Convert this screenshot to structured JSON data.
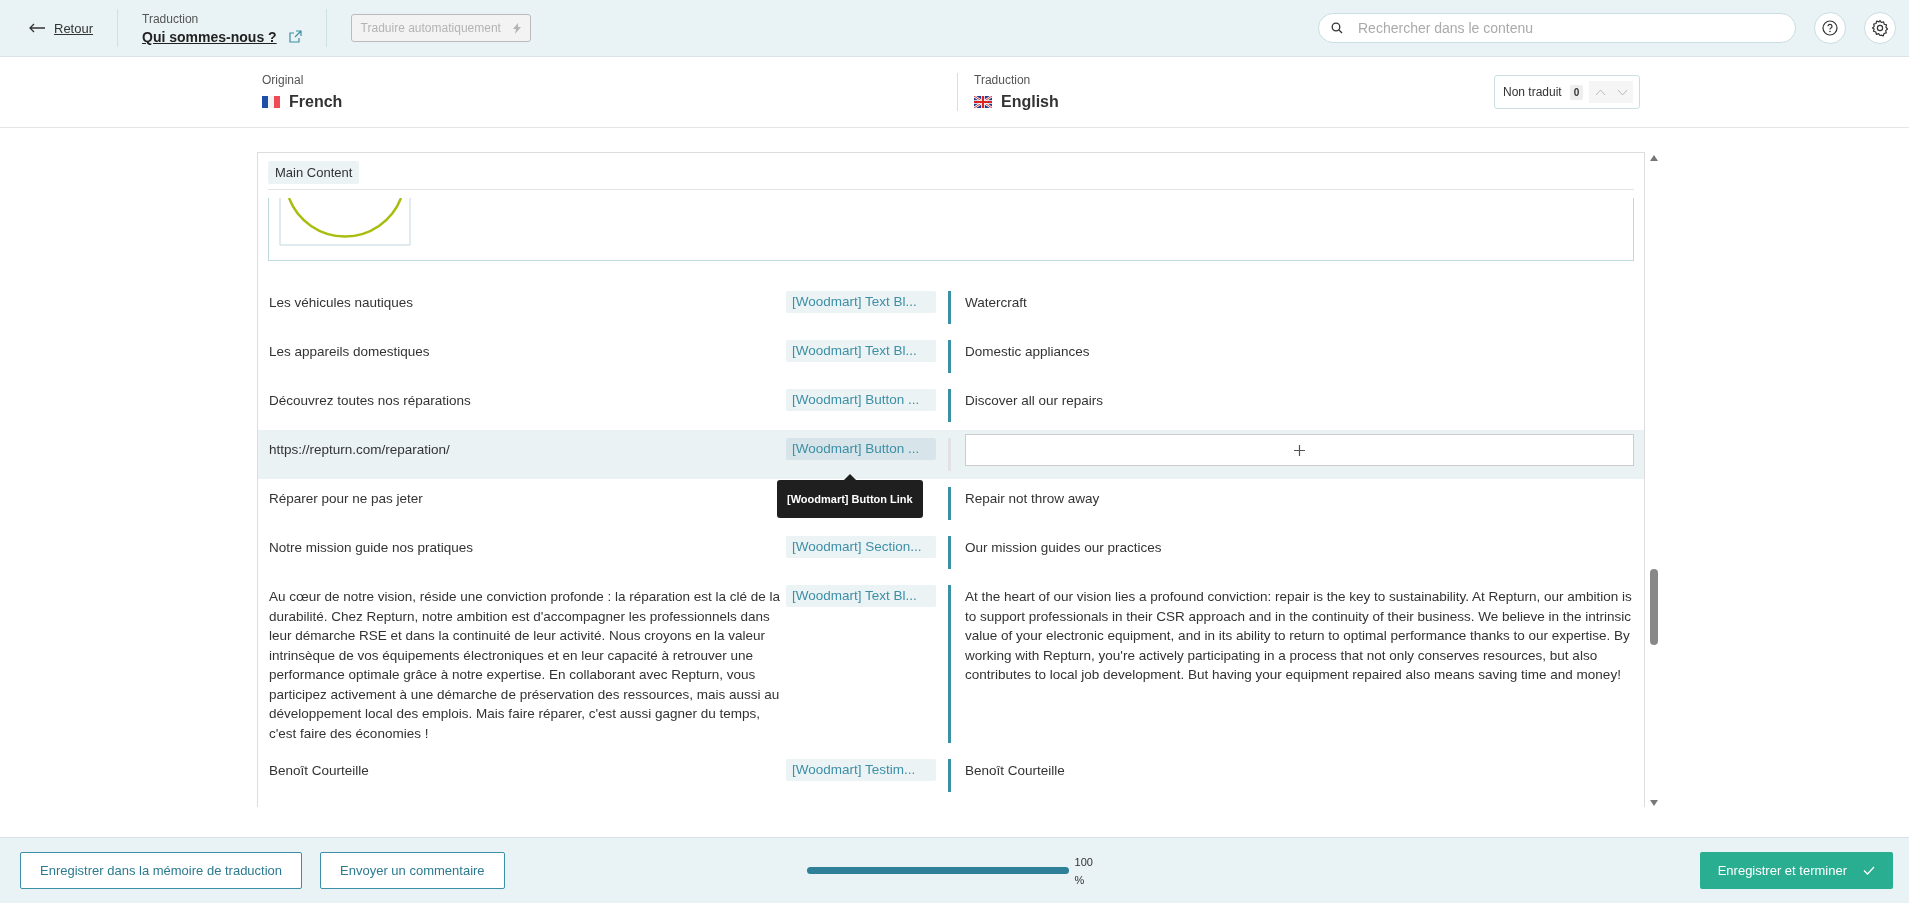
{
  "top_bar": {
    "back": "Retour",
    "section_label": "Traduction",
    "page_title": "Qui sommes-nous ?",
    "auto_translate": {
      "label": "Traduire automatiquement",
      "disabled": true
    },
    "search": {
      "placeholder": "Rechercher dans le contenu"
    }
  },
  "languages": {
    "original": {
      "label": "Original",
      "name": "French"
    },
    "translation": {
      "label": "Traduction",
      "name": "English"
    },
    "filter": {
      "label": "Non traduit",
      "count": "0"
    }
  },
  "section": {
    "title": "Main Content"
  },
  "rows": [
    {
      "source": "Les véhicules nautiques",
      "tag": "[Woodmart] Text Bl...",
      "kind": "translated",
      "translation": "Watercraft",
      "selected": false
    },
    {
      "source": "Les appareils domestiques",
      "tag": "[Woodmart] Text Bl...",
      "kind": "translated",
      "translation": "Domestic appliances",
      "selected": false
    },
    {
      "source": "Découvrez toutes nos réparations",
      "tag": "[Woodmart] Button ...",
      "kind": "translated",
      "translation": "Discover all our repairs",
      "selected": false
    },
    {
      "source": "https://repturn.com/reparation/",
      "tag": "[Woodmart] Button ...",
      "kind": "empty",
      "selected": true,
      "tooltip": "[Woodmart] Button Link"
    },
    {
      "source": "Réparer pour ne pas jeter",
      "kind": "translated",
      "translation": "Repair not throw away",
      "selected": false
    },
    {
      "source": "Notre mission guide nos pratiques",
      "tag": "[Woodmart] Section...",
      "kind": "translated",
      "translation": "Our mission guides our practices",
      "selected": false
    },
    {
      "source": "Au cœur de notre vision, réside une conviction profonde : la réparation est la clé de la durabilité. Chez Repturn, notre ambition est d'accompagner les professionnels dans leur démarche RSE et dans la continuité de leur activité. Nous croyons en la valeur intrinsèque de vos équipements électroniques et en leur capacité à retrouver une performance optimale grâce à notre expertise. En collaborant avec Repturn, vous participez activement à une démarche de préservation des ressources, mais aussi au développement local des emplois. Mais faire réparer, c'est aussi gagner du temps, c'est faire des économies !",
      "tag": "[Woodmart] Text Bl...",
      "kind": "translated",
      "translation": "At the heart of our vision lies a profound conviction: repair is the key to sustainability. At Repturn, our ambition is to support professionals in their CSR approach and in the continuity of their business. We believe in the intrinsic value of your electronic equipment, and in its ability to return to optimal performance thanks to our expertise. By working with Repturn, you're actively participating in a process that not only conserves resources, but also contributes to local job development. But having your equipment repaired also means saving time and money!",
      "selected": false
    },
    {
      "source": "Benoît Courteille",
      "tag": "[Woodmart] Testim...",
      "kind": "translated",
      "translation": "Benoît Courteille",
      "selected": false
    }
  ],
  "footer": {
    "buttons": [
      "Enregistrer dans la mémoire de traduction",
      "Envoyer un commentaire"
    ],
    "progress": {
      "level": 1,
      "reading": "100 %"
    },
    "finish": "Enregistrer et terminer"
  }
}
